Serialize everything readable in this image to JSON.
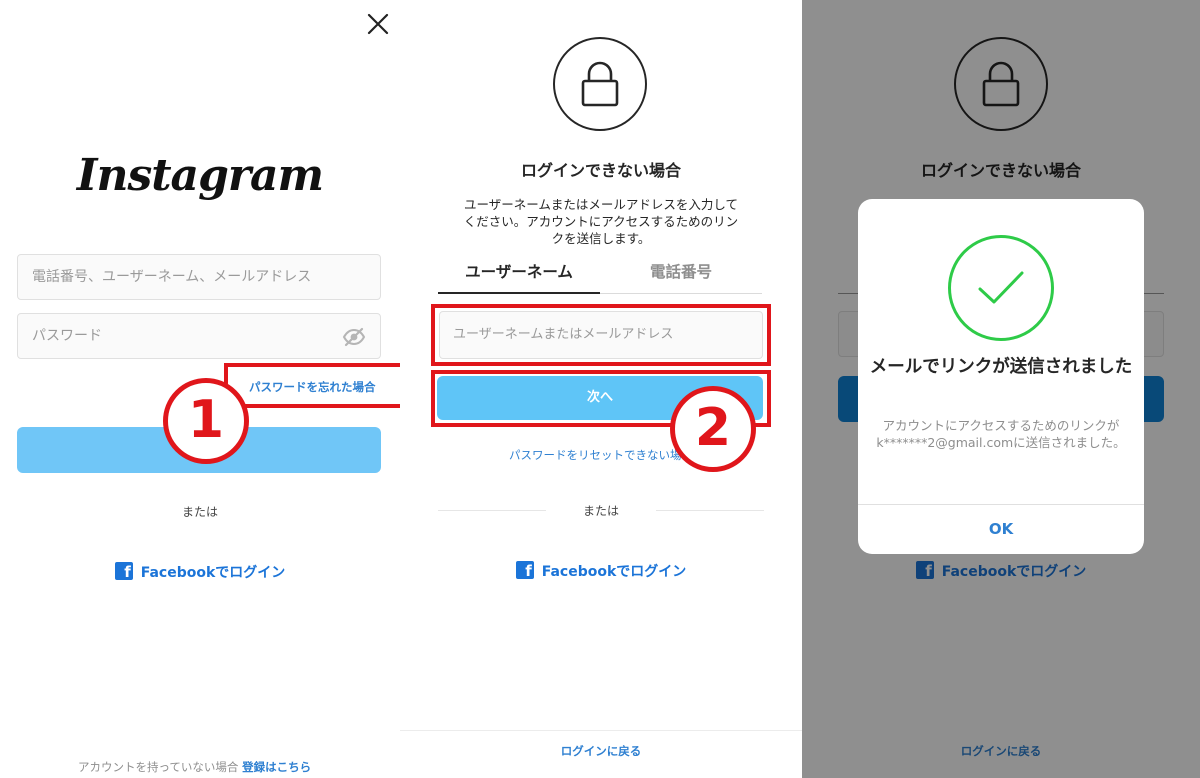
{
  "login": {
    "logo_text": "Instagram",
    "username_placeholder": "電話番号、ユーザーネーム、メールアドレス",
    "password_placeholder": "パスワード",
    "forgot_password": "パスワードを忘れた場合",
    "or_text": "または",
    "facebook_login": "Facebookでログイン",
    "no_account_text": "アカウントを持っていない場合",
    "signup_link": "登録はこちら",
    "step_marker": "1"
  },
  "reset": {
    "title": "ログインできない場合",
    "description": "ユーザーネームまたはメールアドレスを入力してください。アカウントにアクセスするためのリンクを送信します。",
    "tabs": [
      {
        "label": "ユーザーネーム",
        "active": true
      },
      {
        "label": "電話番号",
        "active": false
      }
    ],
    "input_placeholder": "ユーザーネームまたはメールアドレス",
    "next_button": "次へ",
    "cant_reset_link": "パスワードをリセットできない場合",
    "or_text": "または",
    "facebook_login": "Facebookでログイン",
    "back_to_login": "ログインに戻る",
    "step_marker": "2"
  },
  "confirmation": {
    "bg_title": "ログインできない場合",
    "facebook_login": "Facebookでログイン",
    "back_to_login": "ログインに戻る",
    "modal": {
      "title": "メールでリンクが送信されました",
      "body": "アカウントにアクセスするためのリンクがk*******2@gmail.comに送信されました。",
      "ok_button": "OK"
    }
  },
  "colors": {
    "annotation_red": "#e0161b",
    "link_blue": "#2f80d1",
    "button_light_blue": "#70c6f7",
    "success_green": "#2ecb48",
    "facebook_blue": "#1b74d8"
  }
}
